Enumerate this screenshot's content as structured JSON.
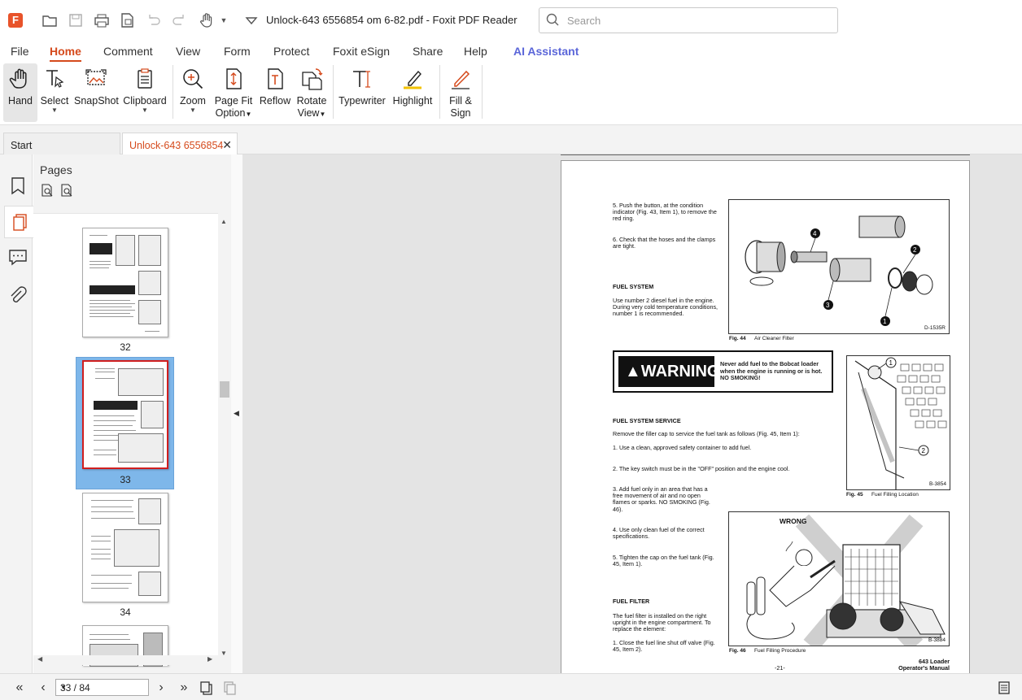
{
  "app": {
    "window_title": "Unlock-643 6556854 om 6-82.pdf - Foxit PDF Reader",
    "search_placeholder": "Search",
    "accent": "#d54a1c"
  },
  "menu": [
    "File",
    "Home",
    "Comment",
    "View",
    "Form",
    "Protect",
    "Foxit eSign",
    "Share",
    "Help",
    "AI Assistant"
  ],
  "ribbon": {
    "hand": "Hand",
    "select": "Select",
    "snapshot": "SnapShot",
    "clipboard": "Clipboard",
    "zoom": "Zoom",
    "pagefit_1": "Page Fit",
    "pagefit_2": "Option",
    "reflow": "Reflow",
    "rotate_1": "Rotate",
    "rotate_2": "View",
    "typewriter": "Typewriter",
    "highlight": "Highlight",
    "fill_1": "Fill &",
    "fill_2": "Sign"
  },
  "tabs": {
    "start": "Start",
    "doc": "Unlock-643 6556854 ..."
  },
  "pages_panel": {
    "title": "Pages",
    "thumbs": [
      "32",
      "33",
      "34"
    ]
  },
  "pdf": {
    "step5": "5.  Push the button, at the condition indicator (Fig. 43, Item 1), to remove the red ring.",
    "step6": "6.  Check that the hoses and the clamps are tight.",
    "fuel_system_head": "FUEL SYSTEM",
    "fuel_system_body": "Use number 2 diesel fuel in the engine. During very cold temperature conditions, number 1 is recommended.",
    "fig44_label": "Fig. 44",
    "fig44_caption": "Air Cleaner Filter",
    "fig44_code": "D-1535R",
    "warning_word": "WARNING",
    "warning_text_1": "Never add fuel to the Bobcat loader",
    "warning_text_2": "when the engine is running or is hot.",
    "warning_text_3": "NO SMOKING!",
    "service_head": "FUEL SYSTEM SERVICE",
    "service_intro": "Remove the filler cap to service the fuel tank as follows (Fig. 45, Item 1):",
    "service_1": "1.  Use a clean, approved safety container to add fuel.",
    "service_2": "2.  The key switch must be in the \"OFF\" position and the engine cool.",
    "service_3": "3.  Add fuel only in an area that has a free movement of air and no open flames or sparks. NO SMOKING (Fig. 46).",
    "service_4": "4.  Use only clean fuel of the correct specifications.",
    "service_5": "5.  Tighten the cap on the fuel tank (Fig. 45, Item 1).",
    "fig45_label": "Fig. 45",
    "fig45_caption": "Fuel Filling Location",
    "fig45_code": "B-3854",
    "fig46_wrong": "WRONG",
    "fig46_label": "Fig. 46",
    "fig46_caption": "Fuel Filling Procedure",
    "fig46_code": "B-3884",
    "filter_head": "FUEL FILTER",
    "filter_body": "The fuel filter is installed on the right upright in the engine compartment. To replace the element:",
    "filter_1": "1.  Close the fuel line shut off valve (Fig. 45, Item 2).",
    "page_number": "-21-",
    "footer_1": "643 Loader",
    "footer_2": "Operator's Manual"
  },
  "status": {
    "page_field": "33 / 84"
  }
}
